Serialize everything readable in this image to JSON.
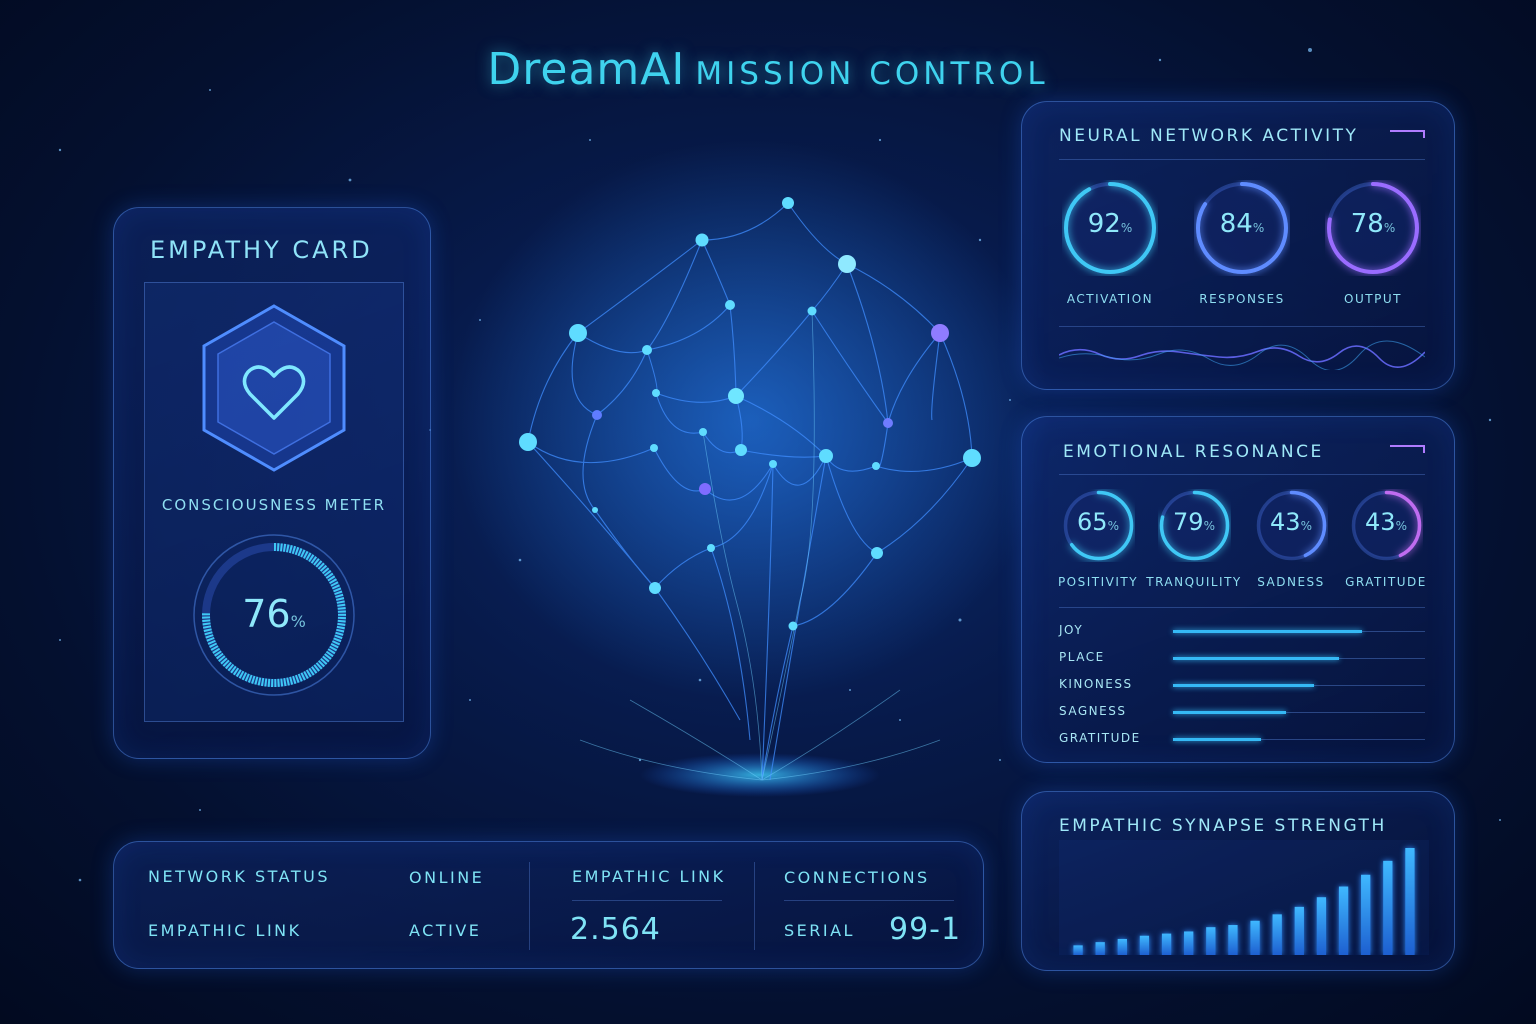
{
  "header": {
    "brand": "DreamAI",
    "subtitle": "MISSION CONTROL"
  },
  "colors": {
    "accent": "#3fd3ee",
    "violet": "#b07cff",
    "bar": "#35b9f5",
    "background": "#04102f"
  },
  "empathy_card": {
    "title": "EMPATHY CARD",
    "icon": "heart-icon",
    "meter_label": "CONSCIOUSNESS METER",
    "meter_value": "76",
    "meter_unit": "%",
    "meter_fraction": 0.76
  },
  "neural_activity": {
    "title": "NEURAL NETWORK ACTIVITY",
    "gauges": [
      {
        "value": "92",
        "unit": "%",
        "label": "ACTIVATION",
        "fraction": 0.92,
        "color": "#3fc8f5"
      },
      {
        "value": "84",
        "unit": "%",
        "label": "RESPONSES",
        "fraction": 0.84,
        "color": "#5f8cff"
      },
      {
        "value": "78",
        "unit": "%",
        "label": "OUTPUT",
        "fraction": 0.78,
        "color": "#9a6cff"
      }
    ]
  },
  "emotional_resonance": {
    "title": "EMOTIONAL RESONANCE",
    "gauges": [
      {
        "value": "65",
        "unit": "%",
        "label": "POSITIVITY",
        "fraction": 0.65,
        "color": "#3fc8f5"
      },
      {
        "value": "79",
        "unit": "%",
        "label": "TRANQUILITY",
        "fraction": 0.79,
        "color": "#3fc8f5"
      },
      {
        "value": "43",
        "unit": "%",
        "label": "SADNESS",
        "fraction": 0.43,
        "color": "#5f8cff"
      },
      {
        "value": "43",
        "unit": "%",
        "label": "GRATITUDE",
        "fraction": 0.43,
        "color": "#c06cf0"
      }
    ],
    "bars": [
      {
        "label": "JOY",
        "fraction": 0.75
      },
      {
        "label": "PLACE",
        "fraction": 0.66
      },
      {
        "label": "KINONESS",
        "fraction": 0.56
      },
      {
        "label": "SAGNESS",
        "fraction": 0.45
      },
      {
        "label": "GRATITUDE",
        "fraction": 0.35
      }
    ]
  },
  "status_bar": {
    "network_status_label": "NETWORK STATUS",
    "network_status_value": "ONLINE",
    "empathic_link_label": "EMPATHIC LINK",
    "empathic_link_value": "ACTIVE",
    "empathic_link_header": "EMPATHIC LINK",
    "empathic_link_number": "2.564",
    "connections_label": "CONNECTIONS",
    "serial_label": "SERIAL",
    "serial_value": "99-1"
  },
  "synapse_strength": {
    "title": "EMPATHIC SYNAPSE STRENGTH"
  },
  "chart_data": {
    "type": "bar",
    "title": "EMPATHIC SYNAPSE STRENGTH",
    "categories": [
      "1",
      "2",
      "3",
      "4",
      "5",
      "6",
      "7",
      "8",
      "9",
      "10",
      "11",
      "12",
      "13",
      "14",
      "15",
      "16"
    ],
    "values": [
      9,
      12,
      15,
      18,
      20,
      22,
      26,
      28,
      32,
      38,
      45,
      54,
      64,
      75,
      88,
      100
    ],
    "ylim": [
      0,
      100
    ],
    "xlabel": "",
    "ylabel": "",
    "grid": false
  }
}
